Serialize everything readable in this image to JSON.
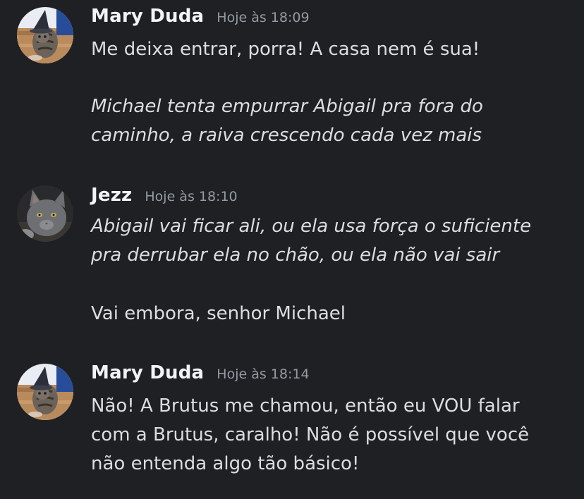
{
  "messages": [
    {
      "author": "Mary Duda",
      "timestamp": "Hoje às 18:09",
      "avatar": "cat-with-witch-hat-avatar",
      "lines": [
        {
          "text": "Me deixa entrar, porra! A casa nem é sua!",
          "italic": false
        },
        {
          "text": "",
          "italic": false
        },
        {
          "text": "Michael tenta empurrar Abigail pra fora do",
          "italic": true
        },
        {
          "text": "caminho, a raiva crescendo cada vez mais",
          "italic": true
        }
      ]
    },
    {
      "author": "Jezz",
      "timestamp": "Hoje às 18:10",
      "avatar": "grey-cat-avatar",
      "lines": [
        {
          "text": "Abigail vai ficar ali, ou ela usa força o suficiente",
          "italic": true
        },
        {
          "text": "pra derrubar ela no chão, ou ela não vai sair",
          "italic": true
        },
        {
          "text": "",
          "italic": false
        },
        {
          "text": "Vai embora, senhor Michael",
          "italic": false
        }
      ]
    },
    {
      "author": "Mary Duda",
      "timestamp": "Hoje às 18:14",
      "avatar": "cat-with-witch-hat-avatar",
      "lines": [
        {
          "text": "Não! A Brutus me chamou, então eu VOU falar",
          "italic": false
        },
        {
          "text": "com a Brutus, caralho! Não é possível que você",
          "italic": false
        },
        {
          "text": "não entenda algo tão básico!",
          "italic": false
        }
      ]
    }
  ],
  "colors": {
    "background": "#1f2024",
    "username": "#f2f3f5",
    "timestamp": "#949ba4",
    "text": "#dbdee1"
  }
}
